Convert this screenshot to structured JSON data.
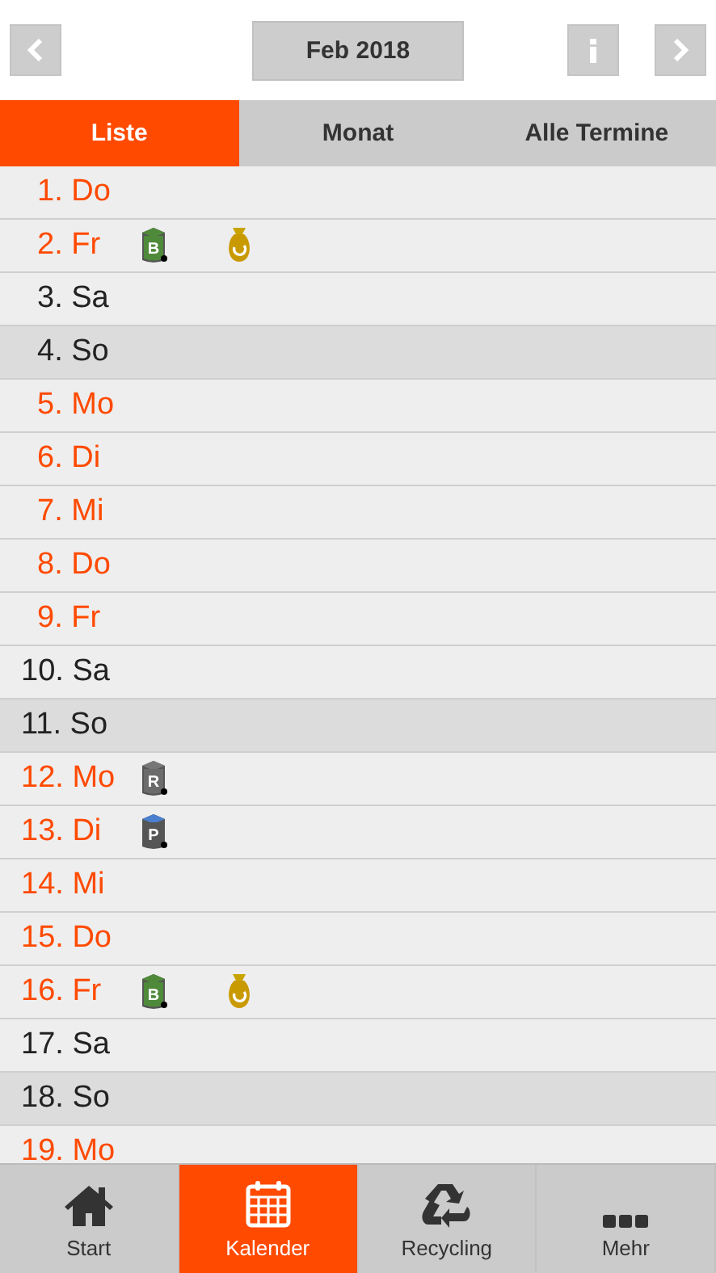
{
  "header": {
    "month": "Feb 2018"
  },
  "tabs": [
    {
      "label": "Liste",
      "selected": true
    },
    {
      "label": "Monat",
      "selected": false
    },
    {
      "label": "Alle Termine",
      "selected": false
    }
  ],
  "days": [
    {
      "label": "1. Do",
      "kind": "weekday"
    },
    {
      "label": "2. Fr",
      "kind": "weekday",
      "events": [
        {
          "kind": "bio-bin",
          "letter": "B"
        },
        {
          "kind": "bag"
        }
      ]
    },
    {
      "label": "3. Sa",
      "kind": "saturday"
    },
    {
      "label": "4. So",
      "kind": "sunday"
    },
    {
      "label": "5. Mo",
      "kind": "weekday"
    },
    {
      "label": "6. Di",
      "kind": "weekday"
    },
    {
      "label": "7. Mi",
      "kind": "weekday"
    },
    {
      "label": "8. Do",
      "kind": "weekday"
    },
    {
      "label": "9. Fr",
      "kind": "weekday"
    },
    {
      "label": "10. Sa",
      "kind": "saturday"
    },
    {
      "label": "11. So",
      "kind": "sunday"
    },
    {
      "label": "12. Mo",
      "kind": "weekday",
      "events": [
        {
          "kind": "residual-bin",
          "letter": "R"
        }
      ]
    },
    {
      "label": "13. Di",
      "kind": "weekday",
      "events": [
        {
          "kind": "paper-bin",
          "letter": "P"
        }
      ]
    },
    {
      "label": "14. Mi",
      "kind": "weekday"
    },
    {
      "label": "15. Do",
      "kind": "weekday"
    },
    {
      "label": "16. Fr",
      "kind": "weekday",
      "events": [
        {
          "kind": "bio-bin",
          "letter": "B"
        },
        {
          "kind": "bag"
        }
      ]
    },
    {
      "label": "17. Sa",
      "kind": "saturday"
    },
    {
      "label": "18. So",
      "kind": "sunday"
    },
    {
      "label": "19. Mo",
      "kind": "weekday"
    }
  ],
  "nav": [
    {
      "label": "Start",
      "selected": false
    },
    {
      "label": "Kalender",
      "selected": true
    },
    {
      "label": "Recycling",
      "selected": false
    },
    {
      "label": "Mehr",
      "selected": false
    }
  ]
}
